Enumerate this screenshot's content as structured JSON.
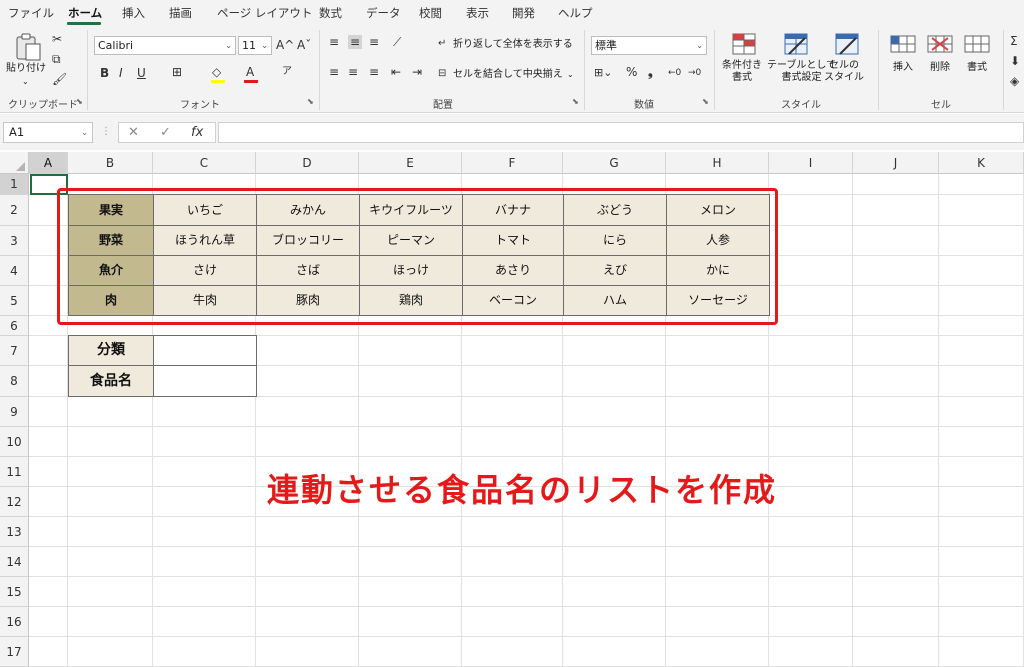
{
  "menu_tabs": [
    "ファイル",
    "ホーム",
    "挿入",
    "描画",
    "ページ レイアウト",
    "数式",
    "データ",
    "校閲",
    "表示",
    "開発",
    "ヘルプ"
  ],
  "ribbon": {
    "clipboard": {
      "paste_label": "貼り付け",
      "group_label": "クリップボード"
    },
    "font": {
      "font_name": "Calibri",
      "font_size": "11",
      "bold": "B",
      "italic": "I",
      "underline": "U",
      "grow": "A^",
      "shrink": "Aˇ",
      "group_label": "フォント"
    },
    "alignment": {
      "wrap_text": "折り返して全体を表示する",
      "merge_center": "セルを結合して中央揃え",
      "group_label": "配置"
    },
    "number": {
      "format": "標準",
      "percent": "%",
      "comma": "❟",
      "group_label": "数値"
    },
    "styles": {
      "conditional": "条件付き\n書式",
      "as_table": "テーブルとして\n書式設定",
      "cell_styles": "セルの\nスタイル",
      "group_label": "スタイル"
    },
    "cells": {
      "insert": "挿入",
      "delete": "削除",
      "format": "書式",
      "group_label": "セル"
    }
  },
  "formula_bar": {
    "name_box": "A1",
    "cancel": "✕",
    "enter": "✓",
    "fx": "fx",
    "value": ""
  },
  "columns": [
    "A",
    "B",
    "C",
    "D",
    "E",
    "F",
    "G",
    "H",
    "I",
    "J",
    "K"
  ],
  "rows": [
    "1",
    "2",
    "3",
    "4",
    "5",
    "6",
    "7",
    "8",
    "9",
    "10",
    "11",
    "12",
    "13",
    "14",
    "15",
    "16",
    "17"
  ],
  "table": [
    {
      "category": "果実",
      "items": [
        "いちご",
        "みかん",
        "キウイフルーツ",
        "バナナ",
        "ぶどう",
        "メロン"
      ]
    },
    {
      "category": "野菜",
      "items": [
        "ほうれん草",
        "ブロッコリー",
        "ピーマン",
        "トマト",
        "にら",
        "人参"
      ]
    },
    {
      "category": "魚介",
      "items": [
        "さけ",
        "さば",
        "ほっけ",
        "あさり",
        "えび",
        "かに"
      ]
    },
    {
      "category": "肉",
      "items": [
        "牛肉",
        "豚肉",
        "鶏肉",
        "ベーコン",
        "ハム",
        "ソーセージ"
      ]
    }
  ],
  "input_labels": {
    "classification": "分類",
    "food_name": "食品名"
  },
  "annotation": "連動させる食品名のリストを作成",
  "colors": {
    "accent": "#217346",
    "category_fill": "#c2b98f",
    "item_fill": "#efeadc",
    "highlight": "#e41a1a"
  }
}
